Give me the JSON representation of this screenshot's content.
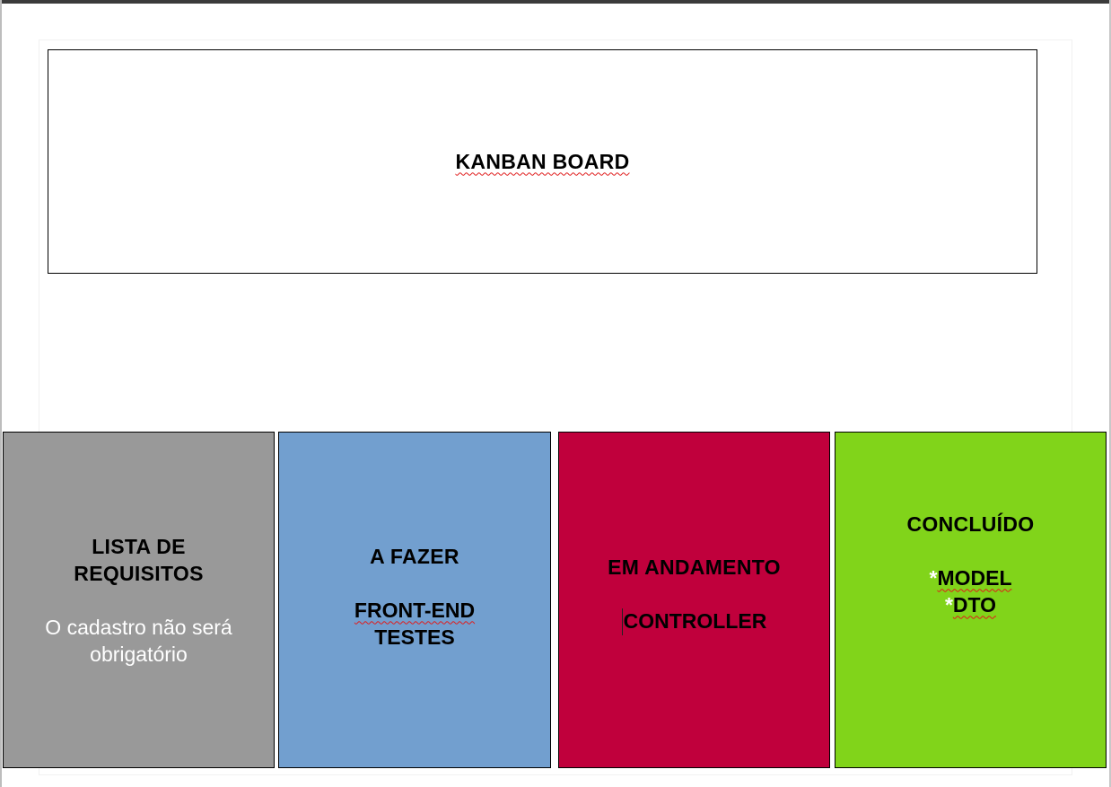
{
  "title_box": {
    "title": "KANBAN BOARD"
  },
  "columns": [
    {
      "title_line1": "LISTA DE",
      "title_line2": "REQUISITOS",
      "body_line1": "O cadastro não será",
      "body_line2": "obrigatório",
      "background": "#999999"
    },
    {
      "title": "A FAZER",
      "items": [
        "FRONT-END",
        "TESTES"
      ],
      "background": "#729fcf"
    },
    {
      "title": "EM ANDAMENTO",
      "items": [
        "CONTROLLER"
      ],
      "background": "#c0003c"
    },
    {
      "title": "CONCLUÍDO",
      "items": [
        {
          "prefix": "*",
          "text": "MODEL"
        },
        {
          "prefix": "*",
          "text": "DTO"
        }
      ],
      "background": "#81d41a"
    }
  ],
  "colors": {
    "border": "#000000",
    "spellcheck_underline": "#e01b1b"
  }
}
